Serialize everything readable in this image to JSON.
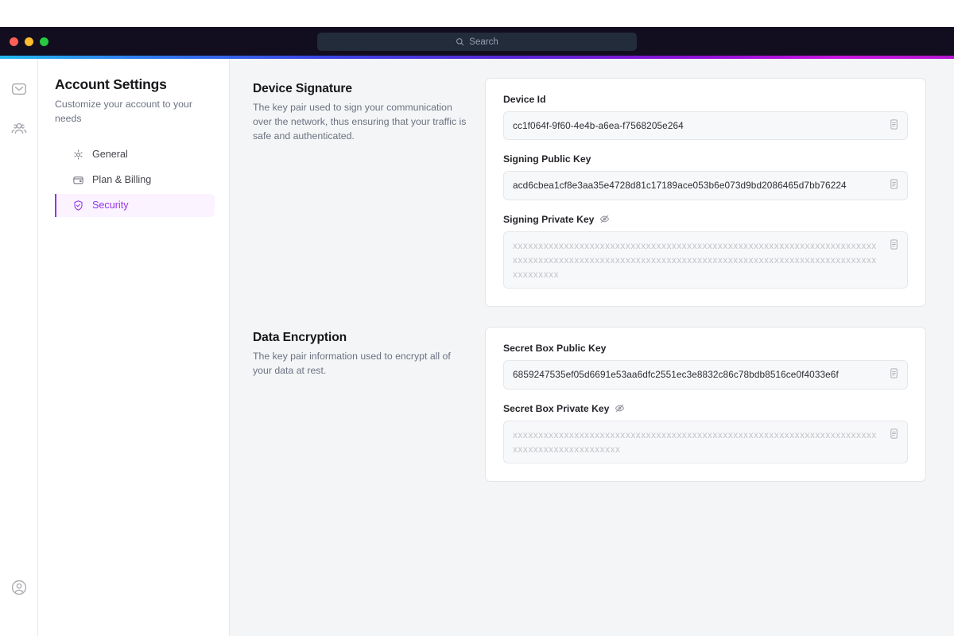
{
  "window": {
    "traffic_lights": [
      "close",
      "minimize",
      "zoom"
    ],
    "search": {
      "icon": "search-icon",
      "placeholder": "Search",
      "value": ""
    },
    "accent_gradient": [
      "#22b8ef",
      "#3b45e4",
      "#9310d8",
      "#c915e0"
    ]
  },
  "rail": {
    "items": [
      {
        "icon": "mail-icon",
        "name": "mail"
      },
      {
        "icon": "people-icon",
        "name": "contacts"
      }
    ],
    "account": {
      "icon": "user-avatar-icon",
      "name": "account"
    }
  },
  "sidebar": {
    "title": "Account Settings",
    "subtitle": "Customize your account to your needs",
    "items": [
      {
        "label": "General",
        "icon": "gear-icon",
        "active": false
      },
      {
        "label": "Plan & Billing",
        "icon": "wallet-icon",
        "active": false
      },
      {
        "label": "Security",
        "icon": "shield-check-icon",
        "active": true
      }
    ],
    "active_color": "#9333ea",
    "active_bg": "#fbf3ff"
  },
  "main": {
    "sections": [
      {
        "heading": "Device Signature",
        "description": "The key pair used to sign your communication over the network, thus ensuring that your traffic is safe and authenticated.",
        "fields": [
          {
            "label": "Device Id",
            "value": "cc1f064f-9f60-4e4b-a6ea-f7568205e264",
            "masked": false,
            "has_visibility_toggle": false,
            "copy_icon": "copy-icon"
          },
          {
            "label": "Signing Public Key",
            "value": "acd6cbea1cf8e3aa35e4728d81c17189ace053b6e073d9bd2086465d7bb76224",
            "masked": false,
            "has_visibility_toggle": false,
            "copy_icon": "copy-icon"
          },
          {
            "label": "Signing Private Key",
            "value": "xxxxxxxxxxxxxxxxxxxxxxxxxxxxxxxxxxxxxxxxxxxxxxxxxxxxxxxxxxxxxxxxxxxxxxxxxxxxxxxxxxxxxxxxxxxxxxxxxxxxxxxxxxxxxxxxxxxxxxxxxxxxxxxxxxxxxxxxxxxxxxxxxxxxxxx",
            "masked": true,
            "has_visibility_toggle": true,
            "visibility_icon": "eye-off-icon",
            "copy_icon": "copy-icon"
          }
        ]
      },
      {
        "heading": "Data Encryption",
        "description": "The key pair information used to encrypt all of your data at rest.",
        "fields": [
          {
            "label": "Secret Box Public Key",
            "value": "6859247535ef05d6691e53aa6dfc2551ec3e8832c86c78bdb8516ce0f4033e6f",
            "masked": false,
            "has_visibility_toggle": false,
            "copy_icon": "copy-icon"
          },
          {
            "label": "Secret Box Private Key",
            "value": "xxxxxxxxxxxxxxxxxxxxxxxxxxxxxxxxxxxxxxxxxxxxxxxxxxxxxxxxxxxxxxxxxxxxxxxxxxxxxxxxxxxxxxxxxxxx",
            "masked": true,
            "has_visibility_toggle": true,
            "visibility_icon": "eye-off-icon",
            "copy_icon": "copy-icon"
          }
        ]
      }
    ]
  }
}
